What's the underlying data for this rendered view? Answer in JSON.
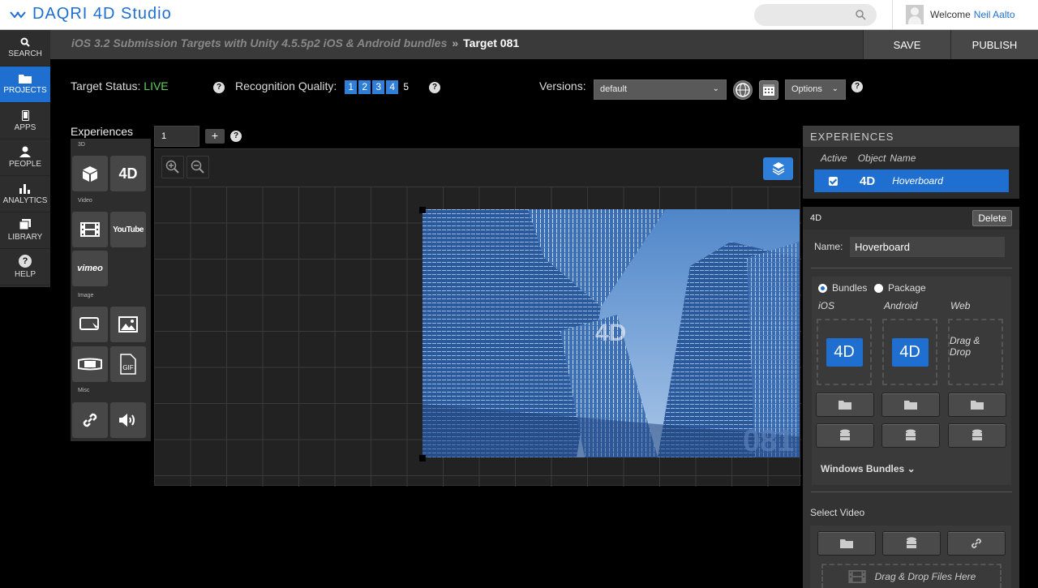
{
  "app": {
    "logo_text": "DAQRI 4D Studio"
  },
  "header": {
    "welcome_prefix": "Welcome",
    "user_name": "Neil Aalto",
    "search_placeholder": ""
  },
  "nav": [
    {
      "label": "SEARCH",
      "icon": "search-icon"
    },
    {
      "label": "PROJECTS",
      "icon": "folder-icon",
      "active": true
    },
    {
      "label": "APPS",
      "icon": "phone-icon"
    },
    {
      "label": "PEOPLE",
      "icon": "person-icon"
    },
    {
      "label": "ANALYTICS",
      "icon": "bar-chart-icon"
    },
    {
      "label": "LIBRARY",
      "icon": "library-icon"
    },
    {
      "label": "HELP",
      "icon": "help-icon"
    }
  ],
  "breadcrumb": {
    "project": "iOS 3.2 Submission Targets with Unity 4.5.5p2 iOS & Android bundles",
    "separator": "»",
    "current": "Target 081"
  },
  "actions": {
    "save": "SAVE",
    "publish": "PUBLISH"
  },
  "status": {
    "label": "Target Status:",
    "value": "LIVE",
    "quality_label": "Recognition Quality:",
    "quality_levels": [
      "1",
      "2",
      "3",
      "4",
      "5"
    ],
    "quality_value": 4,
    "versions_label": "Versions:",
    "versions_value": "default",
    "options_value": "Options"
  },
  "experiences_panel": {
    "title": "Experiences",
    "page_value": "1",
    "add_label": "+",
    "sections": {
      "s3d": "3D",
      "video": "Video",
      "image": "Image",
      "misc": "Misc"
    },
    "tool_4d": "4D",
    "tool_youtube": "YouTube",
    "tool_vimeo": "vimeo",
    "tool_gif": "GIF"
  },
  "canvas": {
    "target_label": "4D",
    "accent": "#1f6fd0"
  },
  "right_panel": {
    "header": "EXPERIENCES",
    "columns": [
      "Active",
      "Object",
      "Name"
    ],
    "rows": [
      {
        "active": true,
        "object": "4D",
        "name": "Hoverboard"
      }
    ],
    "detail": {
      "type": "4D",
      "delete": "Delete",
      "name_label": "Name:",
      "name_value": "Hoverboard",
      "bundles": "Bundles",
      "package": "Package",
      "platforms": [
        "iOS",
        "Android",
        "Web"
      ],
      "badge": "4D",
      "drag_drop": "Drag & Drop",
      "windows_bundles": "Windows Bundles",
      "select_video": "Select Video",
      "drop_files": "Drag & Drop Files Here"
    }
  }
}
